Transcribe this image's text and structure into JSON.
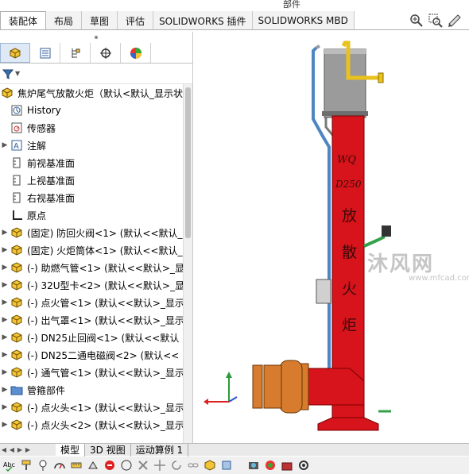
{
  "top_tabs": [
    {
      "label": "装配体",
      "active": true
    },
    {
      "label": "布局"
    },
    {
      "label": "草图"
    },
    {
      "label": "评估"
    },
    {
      "label": "SOLIDWORKS 插件"
    },
    {
      "label": "SOLIDWORKS MBD"
    }
  ],
  "top_strip_text": "部件",
  "tree": {
    "root_label": "焦炉尾气放散火炬（默认<默认_显示状",
    "items": [
      {
        "label": "History",
        "icon": "history-icon",
        "expander": false
      },
      {
        "label": "传感器",
        "icon": "sensor-icon",
        "expander": false
      },
      {
        "label": "注解",
        "icon": "annotation-icon",
        "expander": true
      },
      {
        "label": "前视基准面",
        "icon": "plane-icon",
        "expander": false
      },
      {
        "label": "上视基准面",
        "icon": "plane-icon",
        "expander": false
      },
      {
        "label": "右视基准面",
        "icon": "plane-icon",
        "expander": false
      },
      {
        "label": "原点",
        "icon": "origin-icon",
        "expander": false
      },
      {
        "label": "(固定) 防回火阀<1> (默认<<默认_",
        "icon": "part-icon",
        "expander": true
      },
      {
        "label": "(固定) 火炬筒体<1> (默认<<默认_",
        "icon": "part-icon",
        "expander": true
      },
      {
        "label": "(-) 助燃气管<1> (默认<<默认>_显",
        "icon": "part-icon",
        "expander": true
      },
      {
        "label": "(-) 32U型卡<2> (默认<<默认>_显",
        "icon": "part-icon",
        "expander": true
      },
      {
        "label": "(-) 点火管<1> (默认<<默认>_显示",
        "icon": "part-icon",
        "expander": true
      },
      {
        "label": "(-) 出气罩<1> (默认<<默认>_显示",
        "icon": "part-icon",
        "expander": true
      },
      {
        "label": "(-) DN25止回阀<1> (默认<<默认",
        "icon": "part-icon",
        "expander": true
      },
      {
        "label": "(-) DN25二通电磁阀<2> (默认<<",
        "icon": "part-icon",
        "expander": true
      },
      {
        "label": "(-) 通气管<1> (默认<<默认>_显示",
        "icon": "part-icon",
        "expander": true
      },
      {
        "label": "管箍部件",
        "icon": "folder-icon",
        "expander": true
      },
      {
        "label": "(-) 点火头<1> (默认<<默认>_显示",
        "icon": "part-icon",
        "expander": true
      },
      {
        "label": "(-) 点火头<2> (默认<<默认>_显示",
        "icon": "part-icon",
        "expander": true
      }
    ]
  },
  "viewport": {
    "model_text": [
      "WQ",
      "D250",
      "放",
      "散",
      "火",
      "炬"
    ],
    "watermark": "沐风网",
    "watermark_url": "www.mfcad.com"
  },
  "bottom_tabs": [
    {
      "label": "模型",
      "active": true
    },
    {
      "label": "3D 视图"
    },
    {
      "label": "运动算例 1"
    }
  ],
  "colors": {
    "tower_red": "#d7131b",
    "tower_grey": "#8c8c8c",
    "pipe_blue": "#4e86c2",
    "pipe_yellow": "#e9c21d",
    "flange_orange": "#d77b2e"
  }
}
